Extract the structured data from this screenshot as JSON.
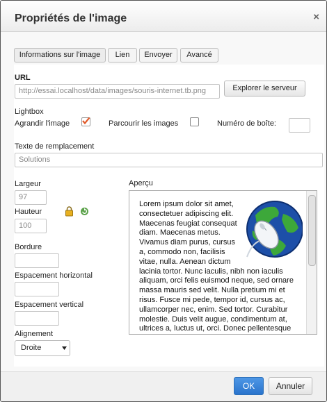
{
  "dialog": {
    "title": "Propriétés de l'image",
    "close_symbol": "×"
  },
  "tabs": [
    {
      "label": "Informations sur l'image",
      "active": true
    },
    {
      "label": "Lien",
      "active": false
    },
    {
      "label": "Envoyer",
      "active": false
    },
    {
      "label": "Avancé",
      "active": false
    }
  ],
  "url": {
    "label": "URL",
    "value": "http://essai.localhost/data/images/souris-internet.tb.png",
    "browse_button": "Explorer le serveur"
  },
  "lightbox": {
    "label": "Lightbox",
    "enlarge_label": "Agrandir l'image",
    "enlarge_checked": true,
    "browse_images_label": "Parcourir les images",
    "browse_images_checked": false,
    "box_number_label": "Numéro de boîte:",
    "box_number_value": ""
  },
  "alt_text": {
    "label": "Texte de remplacement",
    "value": "Solutions"
  },
  "dimensions": {
    "width_label": "Largeur",
    "width_value": "97",
    "height_label": "Hauteur",
    "height_value": "100"
  },
  "border": {
    "label": "Bordure",
    "value": ""
  },
  "hspace": {
    "label": "Espacement horizontal",
    "value": ""
  },
  "vspace": {
    "label": "Espacement vertical",
    "value": ""
  },
  "alignment": {
    "label": "Alignement",
    "selected": "Droite"
  },
  "preview": {
    "label": "Aperçu",
    "text": "Lorem ipsum dolor sit amet, consectetuer adipiscing elit. Maecenas feugiat consequat diam. Maecenas metus. Vivamus diam purus, cursus a, commodo non, facilisis vitae, nulla. Aenean dictum lacinia tortor. Nunc iaculis, nibh non iaculis aliquam, orci felis euismod neque, sed ornare massa mauris sed velit. Nulla pretium mi et risus. Fusce mi pede, tempor id, cursus ac, ullamcorper nec, enim. Sed tortor. Curabitur molestie. Duis velit augue, condimentum at, ultrices a, luctus ut, orci. Donec pellentesque egestas eros. Integer cursus, augue in cursus"
  },
  "footer": {
    "ok_label": "OK",
    "cancel_label": "Annuler"
  },
  "colors": {
    "primary_button": "#2a74cc",
    "checkbox_accent": "#e15a2a"
  }
}
